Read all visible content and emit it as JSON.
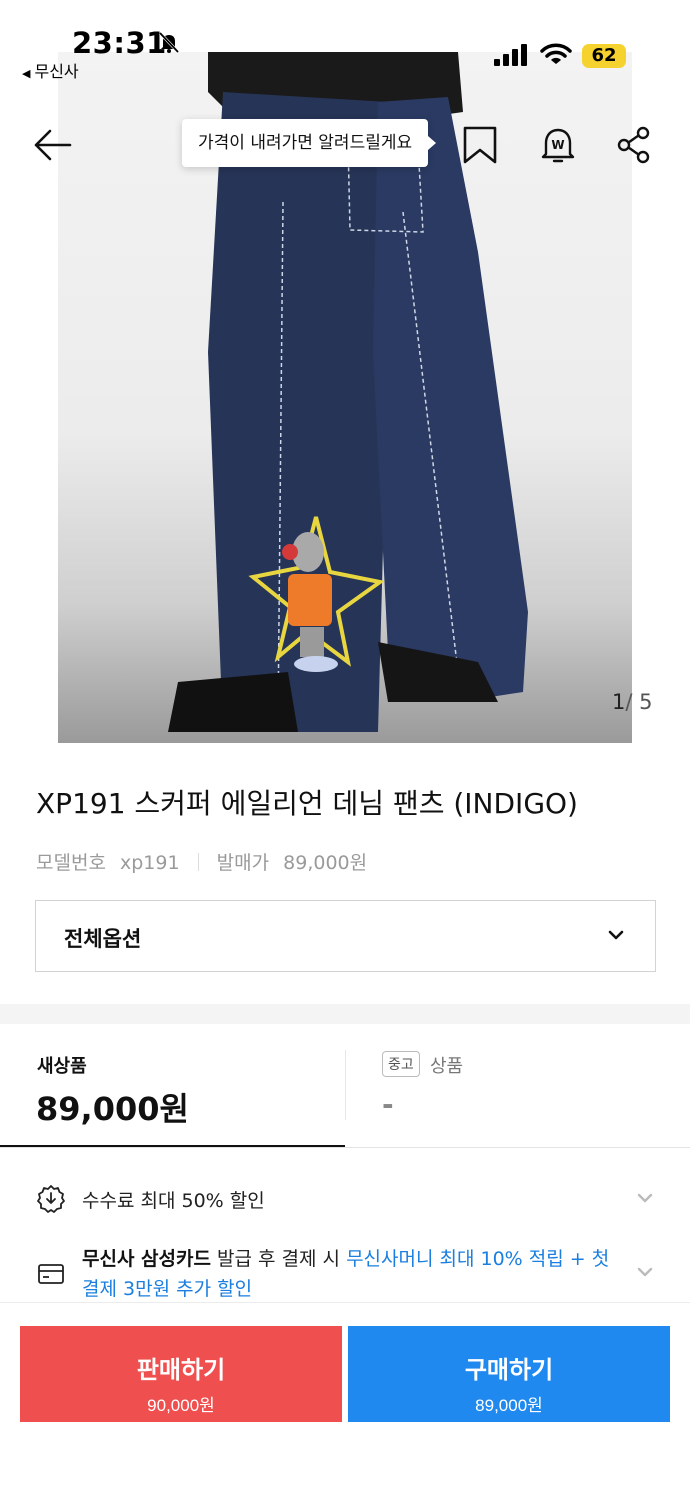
{
  "status_bar": {
    "time": "23:31",
    "back_app": "무신사",
    "battery": "62",
    "icons": [
      "bell-off-icon",
      "signal-icon",
      "wifi-icon",
      "battery-icon"
    ]
  },
  "nav": {
    "tooltip": "가격이 내려가면 알려드릴게요",
    "icons": [
      "back-arrow-icon",
      "bookmark-icon",
      "price-alert-icon",
      "share-icon"
    ]
  },
  "gallery": {
    "current": "1",
    "total": "/ 5"
  },
  "product": {
    "title": "XP191 스커퍼 에일리언 데님 팬츠 (INDIGO)",
    "model_label": "모델번호",
    "model_value": "xp191",
    "release_label": "발매가",
    "release_value": "89,000원"
  },
  "options": {
    "label": "전체옵션"
  },
  "price_tabs": {
    "new_label": "새상품",
    "new_price": "89,000원",
    "used_chip": "중고",
    "used_label": "상품",
    "used_price": "-"
  },
  "benefits": {
    "fee": "수수료 최대 50% 할인",
    "card_bold": "무신사 삼성카드",
    "card_text": " 발급 후 결제 시 ",
    "card_blue": "무신사머니 최대 10% 적립 + 첫 결제 3만원 추가 할인"
  },
  "actions": {
    "sell_label": "판매하기",
    "sell_price": "90,000원",
    "buy_label": "구매하기",
    "buy_price": "89,000원"
  },
  "colors": {
    "sell": "#ef4f4f",
    "buy": "#2089ef",
    "link": "#1a7fe0",
    "battery": "#f5d22e"
  }
}
